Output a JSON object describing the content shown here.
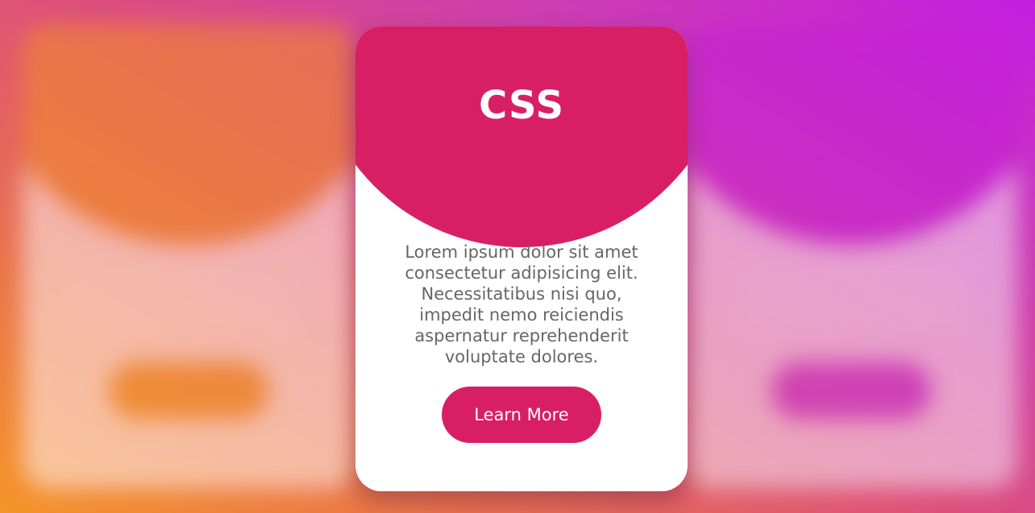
{
  "theme": {
    "accent_left": "#f39029",
    "accent_center": "#d81f65",
    "accent_right": "#c41ed9"
  },
  "cards": [
    {
      "position": "left",
      "blurred": true,
      "title": "",
      "button_label": ""
    },
    {
      "position": "center",
      "blurred": false,
      "title": "CSS",
      "text": "Lorem ipsum dolor sit amet consectetur adipisicing elit. Necessitatibus nisi quo, impedit nemo reiciendis aspernatur reprehenderit voluptate dolores.",
      "button_label": "Learn More"
    },
    {
      "position": "right",
      "blurred": true,
      "title": "",
      "button_label": ""
    }
  ]
}
